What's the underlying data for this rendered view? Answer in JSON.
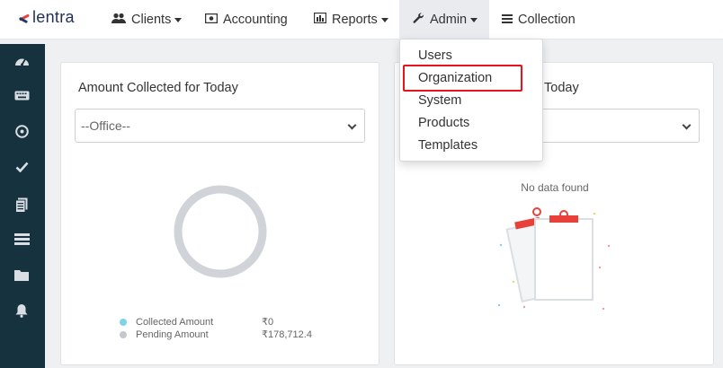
{
  "brand": {
    "name": "lentra"
  },
  "nav": {
    "clients": "Clients",
    "accounting": "Accounting",
    "reports": "Reports",
    "admin": "Admin",
    "collection": "Collection"
  },
  "admin_menu": {
    "items": [
      "Users",
      "Organization",
      "System",
      "Products",
      "Templates"
    ],
    "highlighted": "Organization"
  },
  "left_card": {
    "title": "Amount Collected for Today",
    "office_select": "--Office--",
    "legend": [
      {
        "label": "Collected Amount",
        "value": "₹0",
        "color": "#7fd3e8"
      },
      {
        "label": "Pending Amount",
        "value": "₹178,712.4",
        "color": "#c4c8cc"
      }
    ]
  },
  "right_card": {
    "title_fragment": "Today",
    "empty_text": "No data found"
  },
  "sidebar": {
    "icons": [
      "dashboard-icon",
      "keyboard-icon",
      "compass-icon",
      "check-icon",
      "document-icon",
      "list-icon",
      "folder-icon",
      "bell-icon"
    ]
  },
  "colors": {
    "sidebar": "#16323f",
    "highlight": "#e8141b",
    "accent_red": "#e8413a"
  }
}
